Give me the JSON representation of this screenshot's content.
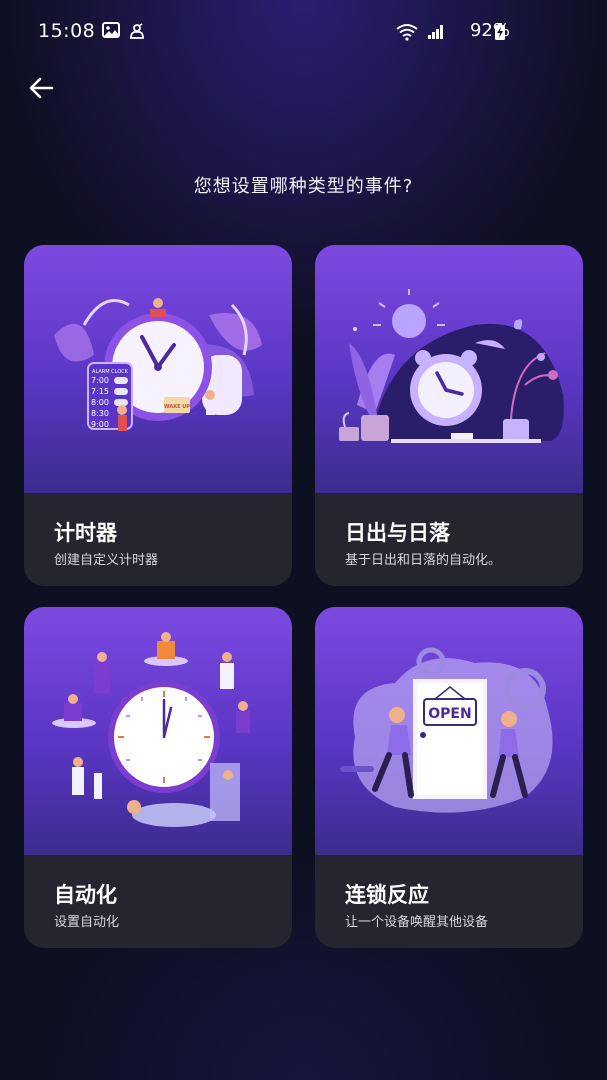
{
  "status_bar": {
    "time": "15:08",
    "battery": "92%"
  },
  "page_title": "您想设置哪种类型的事件?",
  "cards": [
    {
      "title": "计时器",
      "desc": "创建自定义计时器",
      "alarm_label": "ALARM CLOCK",
      "alarm_times": [
        "7:00",
        "7:15",
        "8:00",
        "8:30",
        "9:00"
      ],
      "tag": "WAKE UP"
    },
    {
      "title": "日出与日落",
      "desc": "基于日出和日落的自动化。"
    },
    {
      "title": "自动化",
      "desc": "设置自动化"
    },
    {
      "title": "连锁反应",
      "desc": "让一个设备唤醒其他设备",
      "sign": "OPEN"
    }
  ]
}
